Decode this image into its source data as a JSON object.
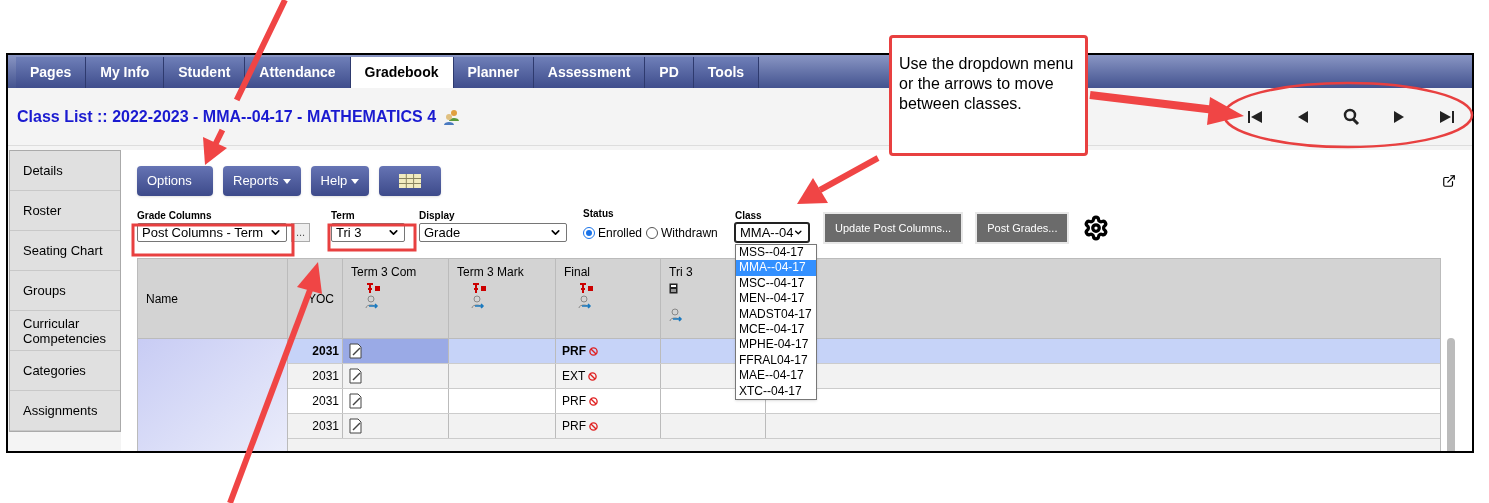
{
  "tabs": [
    {
      "label": "Pages",
      "selected": false
    },
    {
      "label": "My Info",
      "selected": false
    },
    {
      "label": "Student",
      "selected": false
    },
    {
      "label": "Attendance",
      "selected": false
    },
    {
      "label": "Gradebook",
      "selected": true
    },
    {
      "label": "Planner",
      "selected": false
    },
    {
      "label": "Assessment",
      "selected": false
    },
    {
      "label": "PD",
      "selected": false
    },
    {
      "label": "Tools",
      "selected": false
    }
  ],
  "header": {
    "title": "Class List :: 2022-2023 - MMA--04-17 - MATHEMATICS 4"
  },
  "sidebar": {
    "items": [
      {
        "label": "Details"
      },
      {
        "label": "Roster"
      },
      {
        "label": "Seating Chart"
      },
      {
        "label": "Groups"
      },
      {
        "label": "Curricular Competencies"
      },
      {
        "label": "Categories"
      },
      {
        "label": "Assignments"
      }
    ]
  },
  "toolbar": {
    "buttons": [
      {
        "label": "Options",
        "kind": "plain"
      },
      {
        "label": "Reports",
        "kind": "menu"
      },
      {
        "label": "Help",
        "kind": "menu"
      },
      {
        "kind": "grid"
      }
    ]
  },
  "filters": {
    "grade_columns": {
      "label": "Grade Columns",
      "value": "Post Columns - Term",
      "more": "..."
    },
    "term": {
      "label": "Term",
      "value": "Tri 3"
    },
    "display": {
      "label": "Display",
      "value": "Grade"
    },
    "status": {
      "label": "Status",
      "options": [
        {
          "label": "Enrolled",
          "selected": true
        },
        {
          "label": "Withdrawn",
          "selected": false
        }
      ]
    },
    "class": {
      "label": "Class",
      "value": "MMA--04",
      "expanded": true,
      "options": [
        {
          "label": "MSS--04-17",
          "selected": false
        },
        {
          "label": "MMA--04-17",
          "selected": true
        },
        {
          "label": "MSC--04-17",
          "selected": false
        },
        {
          "label": "MEN--04-17",
          "selected": false
        },
        {
          "label": "MADST04-17",
          "selected": false
        },
        {
          "label": "MCE--04-17",
          "selected": false
        },
        {
          "label": "MPHE-04-17",
          "selected": false
        },
        {
          "label": "FFRAL04-17",
          "selected": false
        },
        {
          "label": "MAE--04-17",
          "selected": false
        },
        {
          "label": "XTC--04-17",
          "selected": false
        }
      ]
    }
  },
  "actions": [
    "Update Post Columns...",
    "Post Grades..."
  ],
  "table": {
    "columns": [
      {
        "label": "Name",
        "kind": "name"
      },
      {
        "label": "YOC",
        "kind": "plain"
      },
      {
        "label": "Term 3 Com",
        "kind": "post"
      },
      {
        "label": "Term 3 Mark",
        "kind": "post"
      },
      {
        "label": "Final",
        "kind": "post"
      },
      {
        "label": "Tri 3",
        "kind": "calc"
      }
    ],
    "rows": [
      {
        "yoc": "2031",
        "final": "PRF",
        "selected": true
      },
      {
        "yoc": "2031",
        "final": "EXT",
        "selected": false
      },
      {
        "yoc": "2031",
        "final": "PRF",
        "selected": false
      },
      {
        "yoc": "2031",
        "final": "PRF",
        "selected": false
      }
    ]
  },
  "callout": {
    "text": "Use the dropdown menu or the arrows to move between classes."
  }
}
